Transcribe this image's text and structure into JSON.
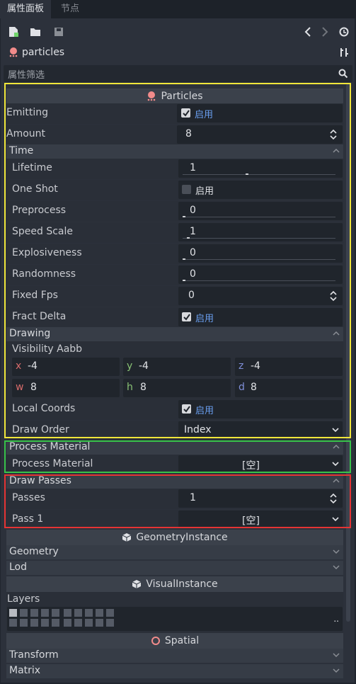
{
  "tabs": {
    "inspector": "属性面板",
    "node": "节点"
  },
  "toolbar": {
    "node_name": "particles"
  },
  "filter": {
    "placeholder": "属性筛选"
  },
  "particles": {
    "header": "Particles",
    "emitting": {
      "label": "Emitting",
      "value": "启用",
      "checked": true
    },
    "amount": {
      "label": "Amount",
      "value": "8"
    },
    "time": {
      "title": "Time",
      "lifetime": {
        "label": "Lifetime",
        "value": "1",
        "fraction": 0.42
      },
      "one_shot": {
        "label": "One Shot",
        "value": "启用",
        "checked": false
      },
      "preprocess": {
        "label": "Preprocess",
        "value": "0",
        "fraction": 0.0
      },
      "speed_scale": {
        "label": "Speed Scale",
        "value": "1",
        "fraction": 0.03
      },
      "explosiveness": {
        "label": "Explosiveness",
        "value": "0",
        "fraction": 0.0
      },
      "randomness": {
        "label": "Randomness",
        "value": "0",
        "fraction": 0.0
      },
      "fixed_fps": {
        "label": "Fixed Fps",
        "value": "0"
      },
      "fract_delta": {
        "label": "Fract Delta",
        "value": "启用",
        "checked": true
      }
    },
    "drawing": {
      "title": "Drawing",
      "visibility_aabb": {
        "label": "Visibility Aabb",
        "x": "-4",
        "y": "-4",
        "z": "-4",
        "w": "8",
        "h": "8",
        "d": "8"
      },
      "local_coords": {
        "label": "Local Coords",
        "value": "启用",
        "checked": true
      },
      "draw_order": {
        "label": "Draw Order",
        "value": "Index"
      }
    },
    "process_material": {
      "title": "Process Material",
      "label": "Process Material",
      "value": "[空]"
    },
    "draw_passes": {
      "title": "Draw Passes",
      "passes": {
        "label": "Passes",
        "value": "1"
      },
      "pass1": {
        "label": "Pass 1",
        "value": "[空]"
      }
    }
  },
  "geometry_instance": {
    "header": "GeometryInstance",
    "geometry": "Geometry",
    "lod": "Lod"
  },
  "visual_instance": {
    "header": "VisualInstance",
    "layers": "Layers",
    "more": ".."
  },
  "spatial": {
    "header": "Spatial",
    "transform": "Transform",
    "matrix": "Matrix"
  },
  "axes": {
    "x": "x",
    "y": "y",
    "z": "z",
    "w": "w",
    "h": "h",
    "d": "d"
  },
  "colors": {
    "accent": "#6a9ff0",
    "axis_x": "#d76b6b",
    "axis_y": "#89c275",
    "axis_z": "#7f8fd9"
  }
}
